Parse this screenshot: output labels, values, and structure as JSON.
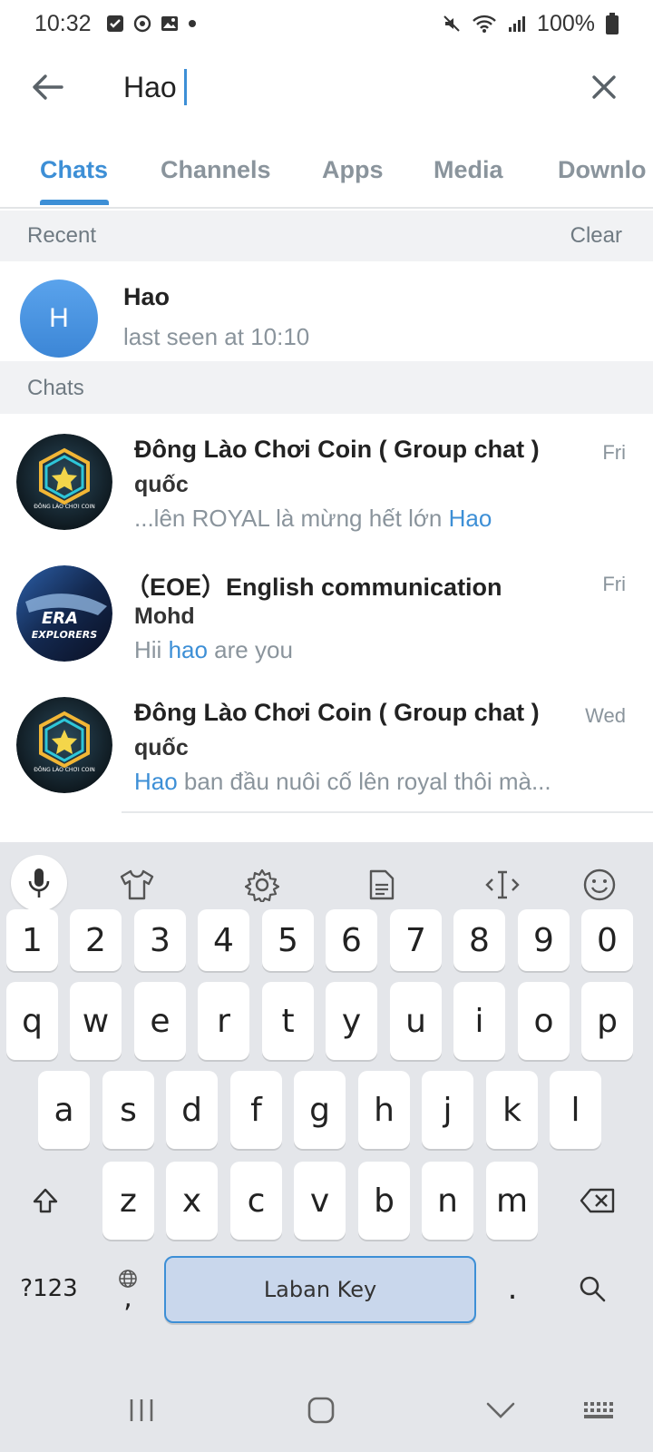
{
  "status_bar": {
    "time": "10:32",
    "battery": "100%"
  },
  "search": {
    "query": "Hao"
  },
  "tabs": [
    {
      "label": "Chats",
      "active": true
    },
    {
      "label": "Channels",
      "active": false
    },
    {
      "label": "Apps",
      "active": false
    },
    {
      "label": "Media",
      "active": false
    },
    {
      "label": "Downlo",
      "active": false
    }
  ],
  "recent": {
    "header": "Recent",
    "clear_label": "Clear",
    "item": {
      "avatar_letter": "H",
      "name": "Hao",
      "status": "last seen at 10:10"
    }
  },
  "chats_section": {
    "header": "Chats"
  },
  "chats": [
    {
      "title": "Đông Lào Chơi Coin ( Group chat )",
      "date": "Fri",
      "sender": "quốc",
      "msg_before": "...lên ROYAL là mừng hết lớn ",
      "msg_highlight": "Hao",
      "msg_after": "",
      "avatar": "dong-lao-logo"
    },
    {
      "title": "（EOE）English communication",
      "date": "Fri",
      "sender": "Mohd",
      "msg_before": "Hii ",
      "msg_highlight": "hao",
      "msg_after": " are you",
      "avatar": "era-of-explorers-logo"
    },
    {
      "title": "Đông Lào Chơi Coin ( Group chat )",
      "date": "Wed",
      "sender": "quốc",
      "msg_before": "",
      "msg_highlight": "Hao",
      "msg_after": " ban đầu nuôi cố lên royal thôi mà...",
      "avatar": "dong-lao-logo"
    }
  ],
  "keyboard": {
    "number_row": [
      "1",
      "2",
      "3",
      "4",
      "5",
      "6",
      "7",
      "8",
      "9",
      "0"
    ],
    "row1": [
      "q",
      "w",
      "e",
      "r",
      "t",
      "y",
      "u",
      "i",
      "o",
      "p"
    ],
    "row2": [
      "a",
      "s",
      "d",
      "f",
      "g",
      "h",
      "j",
      "k",
      "l"
    ],
    "row3": [
      "z",
      "x",
      "c",
      "v",
      "b",
      "n",
      "m"
    ],
    "symbols_label": "?123",
    "comma_label": ",",
    "space_label": "Laban Key",
    "period_label": "."
  },
  "colors": {
    "accent": "#3d8fd6",
    "section_bg": "#f1f2f4",
    "keyboard_bg": "#e4e6ea"
  }
}
